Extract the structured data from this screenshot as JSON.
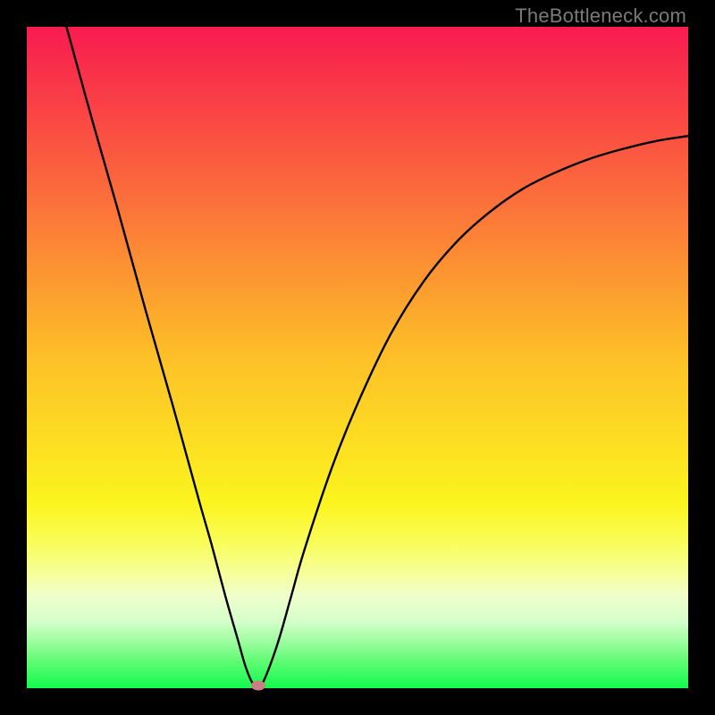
{
  "watermark": "TheBottleneck.com",
  "chart_data": {
    "type": "line",
    "title": "",
    "xlabel": "",
    "ylabel": "",
    "xlim": [
      0,
      100
    ],
    "ylim": [
      0,
      100
    ],
    "series": [
      {
        "name": "curve",
        "x": [
          6,
          10,
          14,
          18,
          22,
          26,
          28,
          30,
          32,
          33,
          34,
          35,
          36,
          38,
          40,
          42,
          46,
          50,
          55,
          60,
          65,
          70,
          75,
          80,
          85,
          90,
          95,
          100
        ],
        "y": [
          100,
          85.5,
          71.5,
          57,
          43,
          28.5,
          21.5,
          14,
          7,
          3.5,
          1,
          0,
          1.5,
          7,
          14,
          21,
          33,
          43,
          53.5,
          61.5,
          67.5,
          72,
          75.5,
          78,
          80,
          81.5,
          82.7,
          83.5
        ]
      }
    ],
    "marker": {
      "x": 35,
      "y": 0
    },
    "gradient_stops": [
      {
        "pos": 0,
        "color": "#f81b4f"
      },
      {
        "pos": 24,
        "color": "#fb683c"
      },
      {
        "pos": 50,
        "color": "#fdc027"
      },
      {
        "pos": 72,
        "color": "#fbf41e"
      },
      {
        "pos": 78,
        "color": "#fafd59"
      },
      {
        "pos": 83,
        "color": "#f6fea0"
      },
      {
        "pos": 86,
        "color": "#f0fecb"
      },
      {
        "pos": 90,
        "color": "#d3feca"
      },
      {
        "pos": 93,
        "color": "#9cfd9e"
      },
      {
        "pos": 96,
        "color": "#5efc73"
      },
      {
        "pos": 100,
        "color": "#11fa4c"
      }
    ]
  }
}
